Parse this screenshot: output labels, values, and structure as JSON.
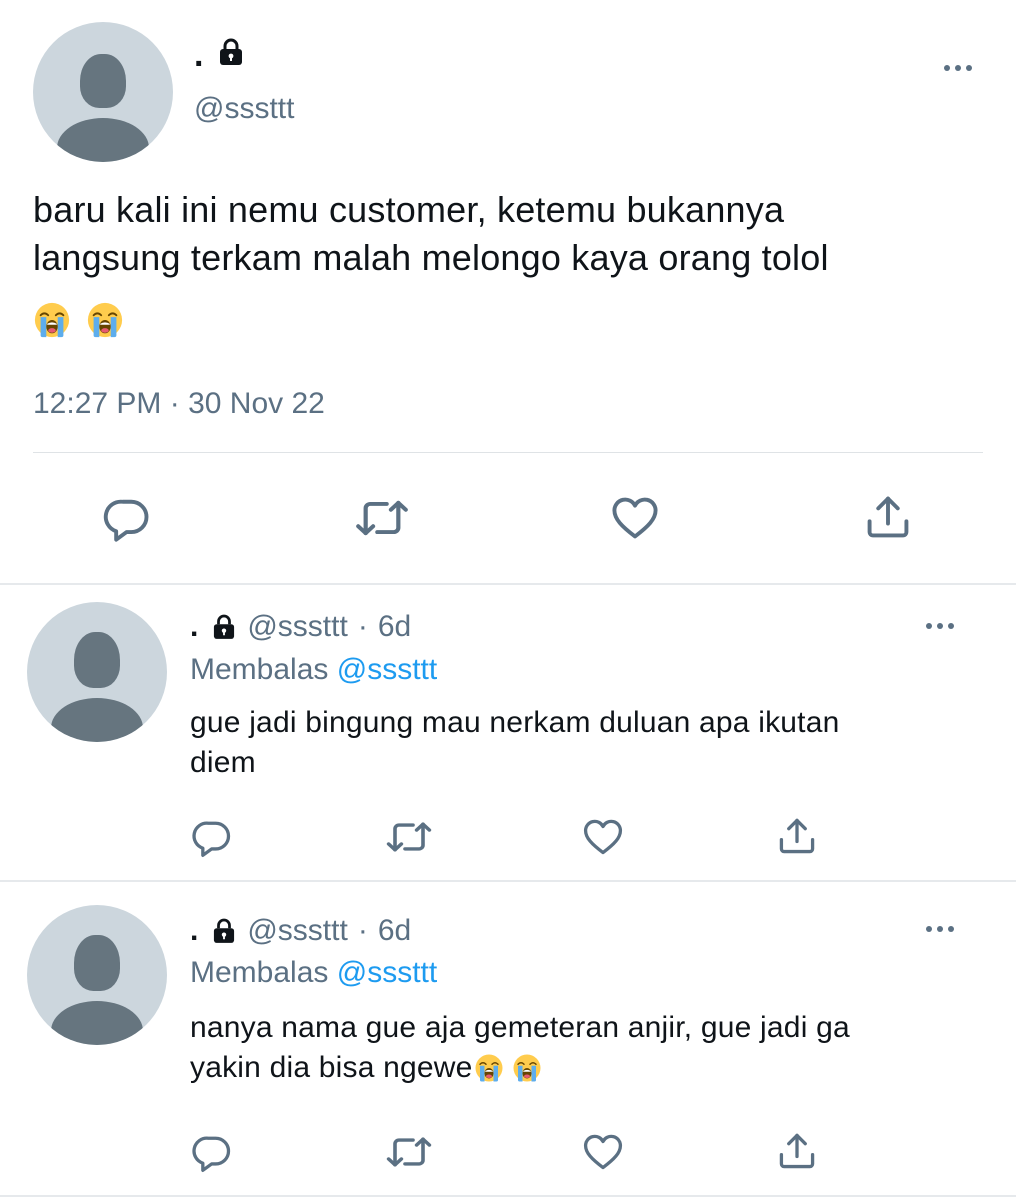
{
  "tweet": {
    "author": {
      "name": ".",
      "handle": "@sssttt",
      "locked": true
    },
    "text_line1": "baru kali ini nemu customer, ketemu bukannya",
    "text_line2": "langsung terkam malah melongo kaya orang tolol",
    "emojis": [
      "loudly-crying-face",
      "loudly-crying-face"
    ],
    "timestamp": "12:27 PM · 30 Nov 22",
    "actions": [
      "reply",
      "retweet",
      "like",
      "share"
    ]
  },
  "replies": [
    {
      "name": ".",
      "handle": "@sssttt",
      "sep": "·",
      "time": "6d",
      "replying_prefix": "Membalas",
      "replying_to": "@sssttt",
      "text_line1": "gue jadi bingung mau nerkam duluan apa ikutan",
      "text_line2": "diem"
    },
    {
      "name": ".",
      "handle": "@sssttt",
      "sep": "·",
      "time": "6d",
      "replying_prefix": "Membalas",
      "replying_to": "@sssttt",
      "text_line1": "nanya nama gue aja gemeteran anjir, gue jadi ga",
      "text_line2": "yakin dia bisa ngewe",
      "emojis": [
        "loudly-crying-face",
        "loudly-crying-face"
      ]
    }
  ],
  "colors": {
    "text": "#0f1419",
    "secondary": "#5b7083",
    "link": "#1d9bf0",
    "avatar_bg": "#ccd6dd",
    "avatar_fg": "#66757f"
  }
}
